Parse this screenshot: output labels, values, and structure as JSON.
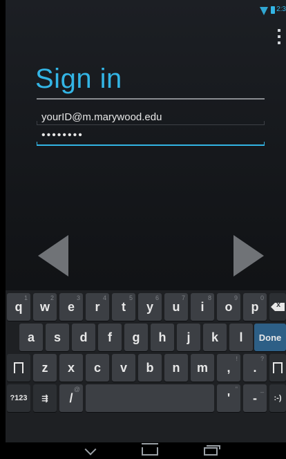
{
  "status_bar": {
    "time": "2:3",
    "wifi_icon": "wifi-icon",
    "battery_icon": "battery-icon",
    "accent": "#33b5e5"
  },
  "overflow_menu_icon": "more-vert-icon",
  "title": "Sign in",
  "email_field": {
    "value": "yourID@m.marywood.edu"
  },
  "password_field": {
    "value": "••••••••"
  },
  "nav_arrows": {
    "prev_icon": "arrow-left-icon",
    "next_icon": "arrow-right-icon"
  },
  "keyboard": {
    "row1": [
      {
        "label": "q",
        "hint": "1"
      },
      {
        "label": "w",
        "hint": "2"
      },
      {
        "label": "e",
        "hint": "3"
      },
      {
        "label": "r",
        "hint": "4"
      },
      {
        "label": "t",
        "hint": "5"
      },
      {
        "label": "y",
        "hint": "6"
      },
      {
        "label": "u",
        "hint": "7"
      },
      {
        "label": "i",
        "hint": "8"
      },
      {
        "label": "o",
        "hint": "9"
      },
      {
        "label": "p",
        "hint": "0"
      }
    ],
    "row2": [
      "a",
      "s",
      "d",
      "f",
      "g",
      "h",
      "j",
      "k",
      "l"
    ],
    "row3": [
      "z",
      "x",
      "c",
      "v",
      "b",
      "n",
      "m"
    ],
    "comma": ",",
    "comma_hint": "!",
    "period": ".",
    "period_hint": "?",
    "done_label": "Done",
    "symbols_label": "?123",
    "settings_label": "⇶",
    "slash_label": "/",
    "slash_hint": "@",
    "apostrophe_label": "'",
    "apostrophe_hint": "\"",
    "dash_label": "-",
    "dash_hint": "_",
    "smiley_label": ":-)"
  },
  "colors": {
    "accent": "#33b5e5",
    "done_key": "#2d5f86",
    "key": "#3c3f44"
  }
}
